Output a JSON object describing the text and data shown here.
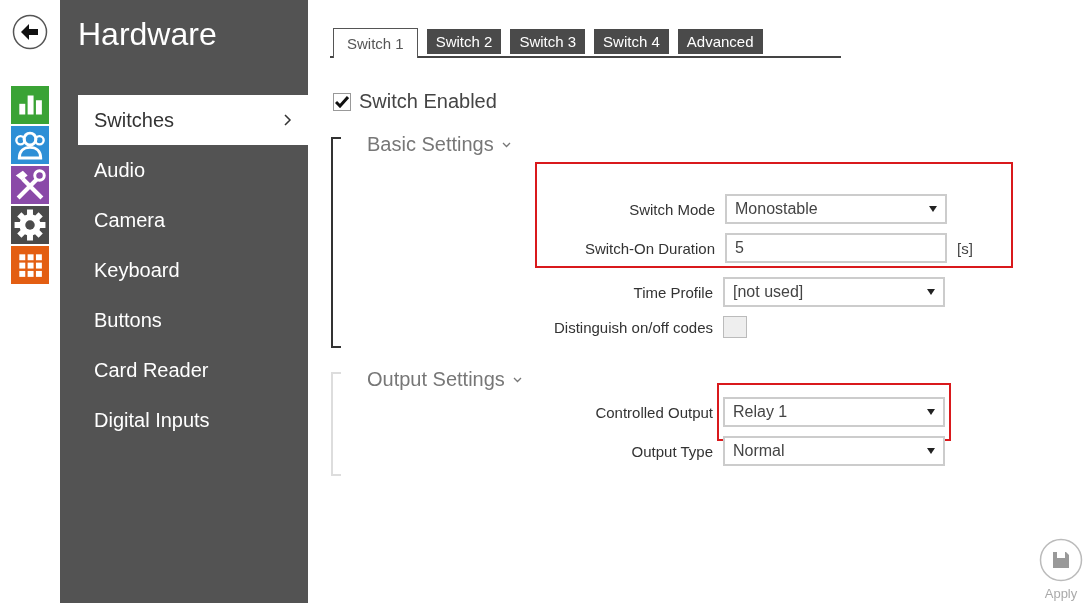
{
  "nav_rail": {
    "items": [
      {
        "kind": "stats",
        "color": "#3aa335"
      },
      {
        "kind": "users",
        "color": "#2e8fd6"
      },
      {
        "kind": "tools",
        "color": "#8a4aa8"
      },
      {
        "kind": "gear",
        "color": "#4a4a4a"
      },
      {
        "kind": "grid",
        "color": "#e35e12"
      }
    ]
  },
  "sidebar": {
    "title": "Hardware",
    "items": [
      {
        "label": "Switches",
        "selected": true
      },
      {
        "label": "Audio",
        "selected": false
      },
      {
        "label": "Camera",
        "selected": false
      },
      {
        "label": "Keyboard",
        "selected": false
      },
      {
        "label": "Buttons",
        "selected": false
      },
      {
        "label": "Card Reader",
        "selected": false
      },
      {
        "label": "Digital Inputs",
        "selected": false
      }
    ]
  },
  "tabs": [
    {
      "label": "Switch 1",
      "selected": true
    },
    {
      "label": "Switch 2",
      "selected": false
    },
    {
      "label": "Switch 3",
      "selected": false
    },
    {
      "label": "Switch 4",
      "selected": false
    },
    {
      "label": "Advanced",
      "selected": false
    }
  ],
  "switch_enabled": {
    "label": "Switch Enabled",
    "checked": true
  },
  "sections": [
    {
      "title": "Basic Settings",
      "focused": true,
      "rows": [
        {
          "kind": "select",
          "label": "Switch Mode",
          "value": "Monostable",
          "row_highlighted": true
        },
        {
          "kind": "text",
          "label": "Switch-On Duration",
          "value": "5",
          "unit": "[s]",
          "row_highlighted": true
        },
        {
          "kind": "select",
          "label": "Time Profile",
          "value": "[not used]"
        },
        {
          "kind": "checkbox",
          "label": "Distinguish on/off codes",
          "checked": false
        }
      ]
    },
    {
      "title": "Output Settings",
      "focused": false,
      "rows": [
        {
          "kind": "select",
          "label": "Controlled Output",
          "value": "Relay 1",
          "field_highlighted": true
        },
        {
          "kind": "select",
          "label": "Output Type",
          "value": "Normal"
        }
      ]
    }
  ],
  "apply_button": {
    "label": "Apply"
  }
}
